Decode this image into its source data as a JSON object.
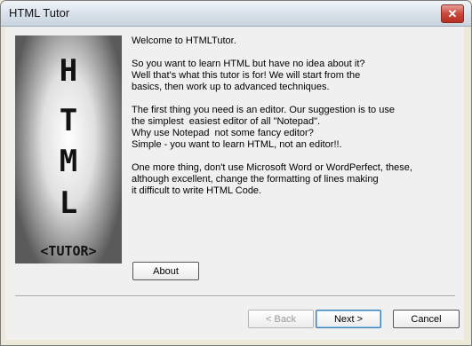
{
  "window": {
    "title": "HTML Tutor",
    "close_glyph": "✕"
  },
  "logo": {
    "letters": [
      "H",
      "T",
      "M",
      "L"
    ],
    "tutor": "<TUTOR>"
  },
  "body_text": [
    "Welcome to HTMLTutor.",
    "So you want to learn HTML but have no idea about it?\nWell that's what this tutor is for! We will start from the\nbasics, then work up to advanced techniques.",
    "The first thing you need is an editor. Our suggestion is to use\nthe simplest  easiest editor of all \"Notepad\".\nWhy use Notepad  not some fancy editor?\nSimple - you want to learn HTML, not an editor!!.",
    "One more thing, don't use Microsoft Word or WordPerfect, these,\nalthough excellent, change the formatting of lines making\nit difficult to write HTML Code."
  ],
  "buttons": {
    "about": "About",
    "back": "< Back",
    "next": "Next >",
    "cancel": "Cancel"
  }
}
